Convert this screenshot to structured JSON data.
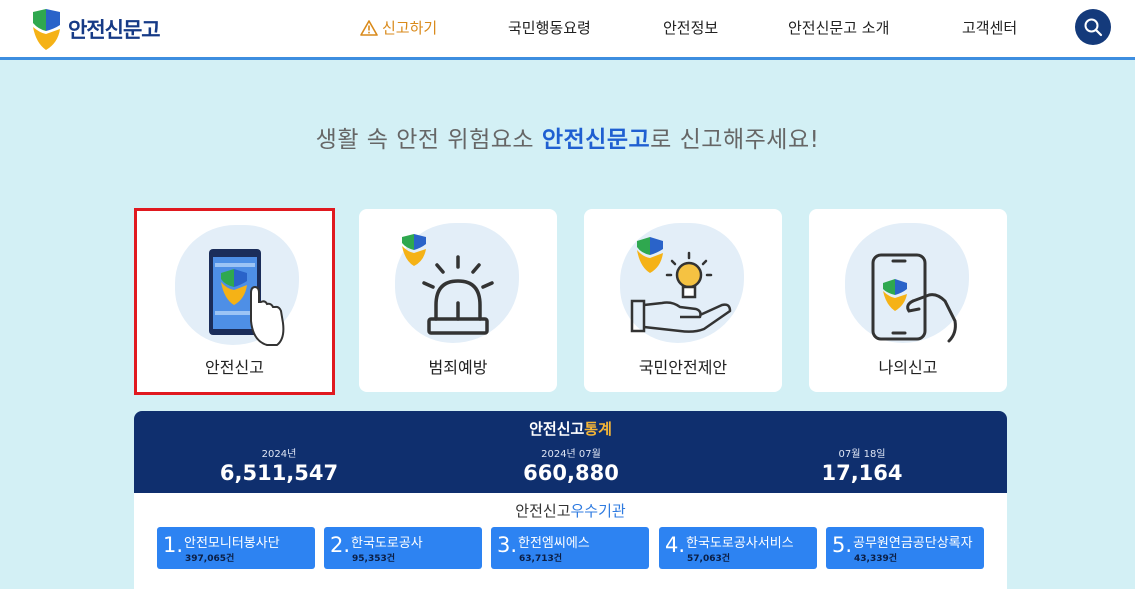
{
  "header": {
    "logo_text": "안전신문고",
    "nav": [
      "신고하기",
      "국민행동요령",
      "안전정보",
      "안전신문고 소개",
      "고객센터"
    ]
  },
  "headline": {
    "prefix": "생활 속 안전 위험요소 ",
    "highlight": "안전신문고",
    "suffix": "로 신고해주세요!"
  },
  "cards": [
    {
      "label": "안전신고",
      "icon": "phone-hand-icon"
    },
    {
      "label": "범죄예방",
      "icon": "siren-icon"
    },
    {
      "label": "국민안전제안",
      "icon": "idea-hand-icon"
    },
    {
      "label": "나의신고",
      "icon": "phone-touch-icon"
    }
  ],
  "stats": {
    "title_main": "안전신고",
    "title_accent": "통계",
    "items": [
      {
        "label": "2024년",
        "value": "6,511,547"
      },
      {
        "label": "2024년 07월",
        "value": "660,880"
      },
      {
        "label": "07월 18일",
        "value": "17,164"
      }
    ]
  },
  "agencies": {
    "title_main": "안전신고",
    "title_accent": "우수기관",
    "items": [
      {
        "num": "1.",
        "name": "안전모니터봉사단",
        "count": "397,065건"
      },
      {
        "num": "2.",
        "name": "한국도로공사",
        "count": "95,353건"
      },
      {
        "num": "3.",
        "name": "한전엠씨에스",
        "count": "63,713건"
      },
      {
        "num": "4.",
        "name": "한국도로공사서비스",
        "count": "57,063건"
      },
      {
        "num": "5.",
        "name": "공무원연금공단상록자",
        "count": "43,339건"
      }
    ]
  },
  "colors": {
    "accent_blue": "#1f5fd1",
    "navy": "#0f2f6e",
    "active_nav": "#d98a1b",
    "selected_border": "#e0191f"
  }
}
